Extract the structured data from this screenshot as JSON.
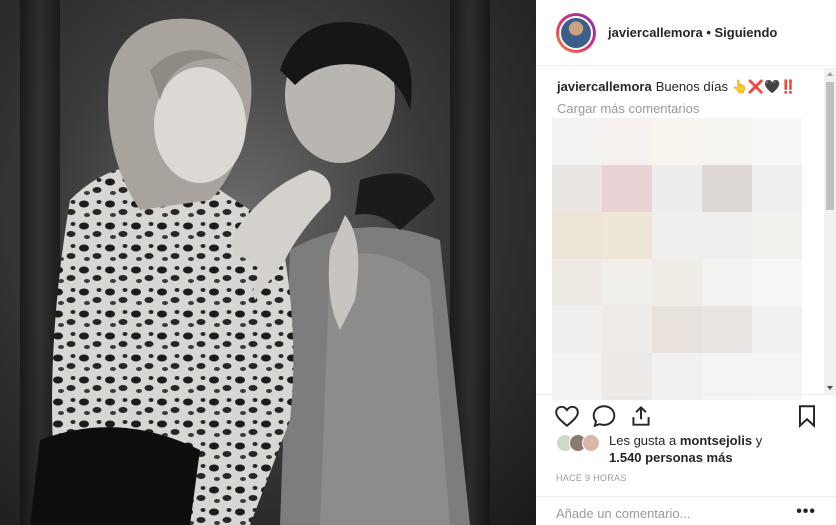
{
  "post": {
    "author": "javiercallemora",
    "separator": "•",
    "follow_status": "Siguiendo",
    "caption_user": "javiercallemora",
    "caption_text": "Buenos días 👆❌🖤‼️",
    "load_more": "Cargar más comentarios",
    "likes_prefix": "Les gusta a",
    "likes_user": "montsejolis",
    "likes_and": "y",
    "likes_count": "1.540 personas más",
    "timestamp": "HACE 9 HORAS",
    "comment_placeholder": "Añade un comentario...",
    "more_options": "•••"
  },
  "icons": {
    "like": "heart-icon",
    "comment": "comment-icon",
    "share": "share-icon",
    "save": "bookmark-icon"
  },
  "pixel_grid_colors": [
    "#f3f3f3",
    "#f6f0ee",
    "#f8f4ee",
    "#f6f4f1",
    "#f7f7f7",
    "#e9e6e4",
    "#ead2d5",
    "#eeeded",
    "#ddd8d4",
    "#eeeeee",
    "#ebe4d7",
    "#eee7d8",
    "#f1efee",
    "#efefef",
    "#f3f1ed",
    "#efeae4",
    "#f1efe9",
    "#efede6",
    "#f4f2f0",
    "#f6f6f6",
    "#efefef",
    "#eeebe9",
    "#e9e1db",
    "#e7e4e1",
    "#f0f0f0",
    "#f2f2f2",
    "#ece9e6",
    "#f1f1f1",
    "#f4f4f4",
    "#f5f5f5"
  ],
  "colors": {
    "text": "#262626",
    "muted": "#999999",
    "border": "#efefef"
  }
}
